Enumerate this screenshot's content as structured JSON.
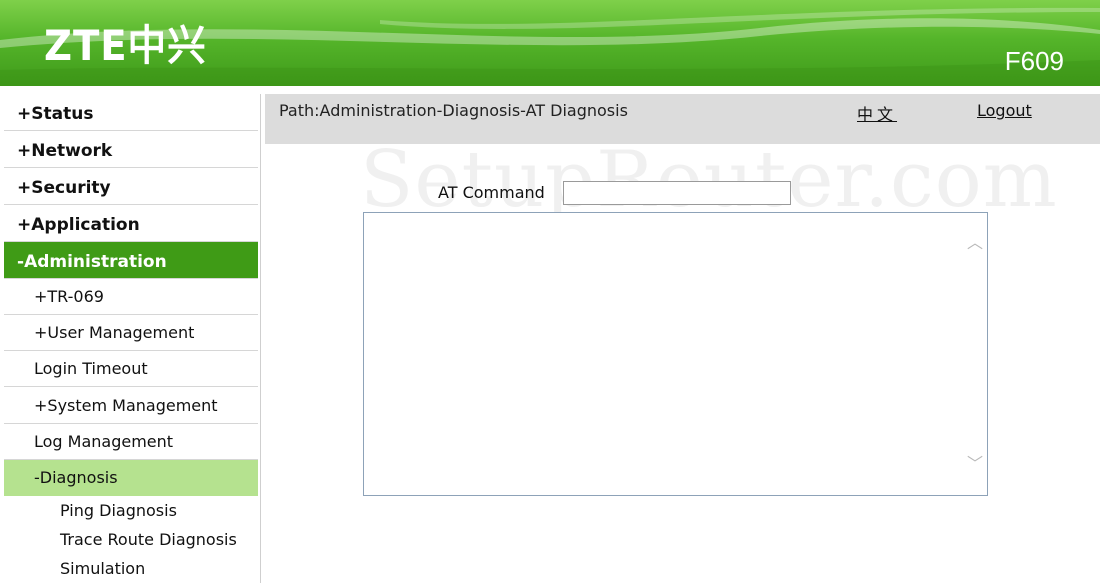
{
  "header": {
    "logo": "ZTE中兴",
    "model": "F609"
  },
  "sidebar": {
    "items": [
      {
        "label": "Status",
        "prefix": "+"
      },
      {
        "label": "Network",
        "prefix": "+"
      },
      {
        "label": "Security",
        "prefix": "+"
      },
      {
        "label": "Application",
        "prefix": "+"
      },
      {
        "label": "Administration",
        "prefix": "-"
      },
      {
        "label": "TR-069",
        "prefix": "+"
      },
      {
        "label": "User Management",
        "prefix": "+"
      },
      {
        "label": "Login Timeout",
        "prefix": ""
      },
      {
        "label": "System Management",
        "prefix": "+"
      },
      {
        "label": "Log Management",
        "prefix": ""
      },
      {
        "label": "Diagnosis",
        "prefix": "-"
      },
      {
        "label": "Ping Diagnosis",
        "prefix": ""
      },
      {
        "label": "Trace Route Diagnosis",
        "prefix": ""
      },
      {
        "label": "Simulation",
        "prefix": ""
      }
    ]
  },
  "pathbar": {
    "path": "Path:Administration-Diagnosis-AT Diagnosis",
    "language": "中文",
    "logout": "Logout"
  },
  "watermark": "SetupRouter.com",
  "form": {
    "at_label": "AT Command",
    "at_value": "",
    "output_value": ""
  },
  "icons": {
    "scroll_up": "chevron-up-icon",
    "scroll_down": "chevron-down-icon"
  },
  "colors": {
    "header_green": "#55b52a",
    "active_green": "#3f9b16",
    "active_light_green": "#b5e28f",
    "path_bar_gray": "#dcdcdc"
  }
}
